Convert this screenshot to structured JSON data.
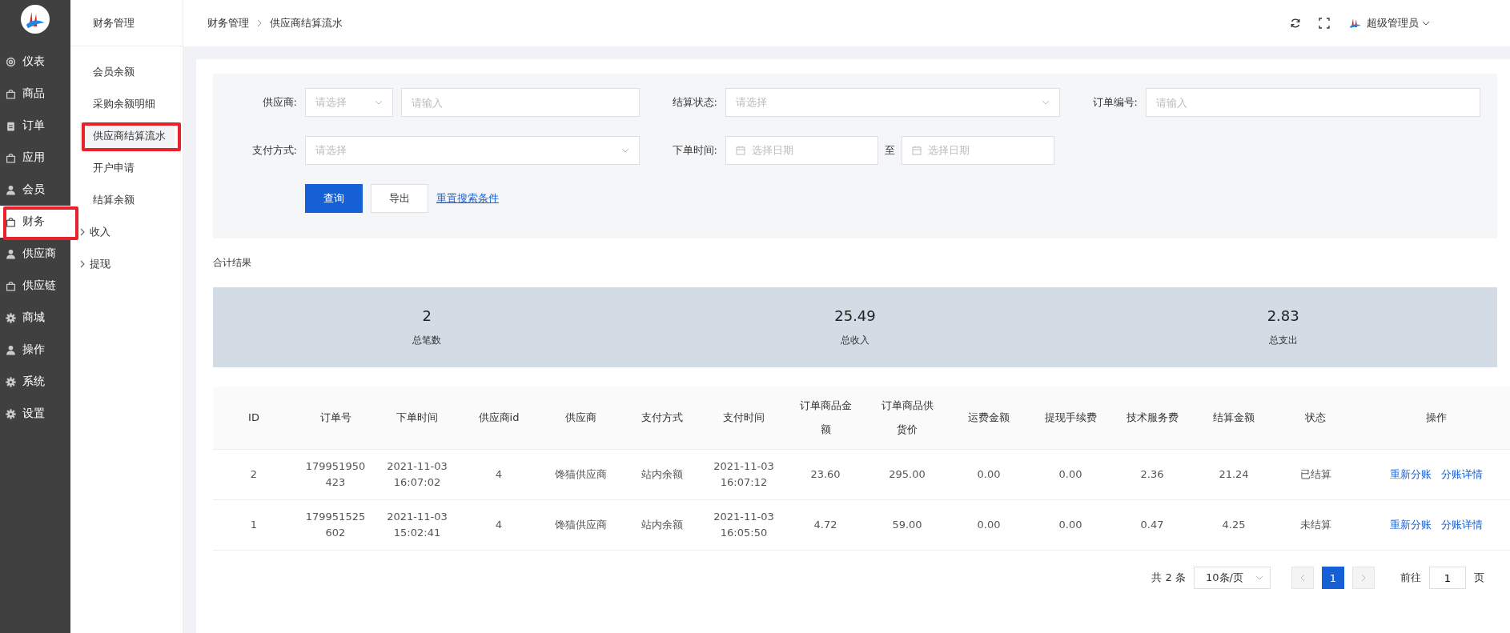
{
  "sidebar": {
    "items": [
      {
        "label": "仪表",
        "selected": false,
        "highlighted": false
      },
      {
        "label": "商品",
        "selected": false,
        "highlighted": false
      },
      {
        "label": "订单",
        "selected": false,
        "highlighted": false
      },
      {
        "label": "应用",
        "selected": false,
        "highlighted": false
      },
      {
        "label": "会员",
        "selected": false,
        "highlighted": false
      },
      {
        "label": "财务",
        "selected": true,
        "highlighted": true
      },
      {
        "label": "供应商",
        "selected": false,
        "highlighted": false
      },
      {
        "label": "供应链",
        "selected": false,
        "highlighted": false
      },
      {
        "label": "商城",
        "selected": false,
        "highlighted": false
      },
      {
        "label": "操作",
        "selected": false,
        "highlighted": false
      },
      {
        "label": "系统",
        "selected": false,
        "highlighted": false
      },
      {
        "label": "设置",
        "selected": false,
        "highlighted": false
      }
    ]
  },
  "submenu": {
    "title": "财务管理",
    "items": [
      {
        "label": "会员余额",
        "kind": "link",
        "selected": false,
        "highlighted": false
      },
      {
        "label": "采购余额明细",
        "kind": "link",
        "selected": false,
        "highlighted": false
      },
      {
        "label": "供应商结算流水",
        "kind": "link",
        "selected": true,
        "highlighted": true
      },
      {
        "label": "开户申请",
        "kind": "link",
        "selected": false,
        "highlighted": false
      },
      {
        "label": "结算余额",
        "kind": "link",
        "selected": false,
        "highlighted": false
      },
      {
        "label": "收入",
        "kind": "group",
        "selected": false,
        "highlighted": false
      },
      {
        "label": "提现",
        "kind": "group",
        "selected": false,
        "highlighted": false
      }
    ]
  },
  "header": {
    "breadcrumb": [
      "财务管理",
      "供应商结算流水"
    ],
    "user_name": "超级管理员"
  },
  "filters": {
    "rows": [
      [
        {
          "label": "供应商:",
          "controls": [
            {
              "kind": "select",
              "placeholder": "请选择"
            },
            {
              "kind": "input",
              "placeholder": "请输入"
            }
          ]
        },
        {
          "label": "结算状态:",
          "controls": [
            {
              "kind": "select",
              "placeholder": "请选择"
            }
          ]
        },
        {
          "label": "订单编号:",
          "controls": [
            {
              "kind": "input",
              "placeholder": "请输入"
            }
          ]
        }
      ],
      [
        {
          "label": "支付方式:",
          "controls": [
            {
              "kind": "select",
              "placeholder": "请选择"
            }
          ]
        },
        {
          "label": "下单时间:",
          "controls": [
            {
              "kind": "date",
              "placeholder": "选择日期"
            },
            {
              "kind": "separator",
              "text": "至"
            },
            {
              "kind": "date",
              "placeholder": "选择日期"
            }
          ]
        }
      ]
    ],
    "buttons": [
      {
        "label": "查询",
        "kind": "primary"
      },
      {
        "label": "导出",
        "kind": "default"
      },
      {
        "label": "重置搜索条件",
        "kind": "link"
      }
    ]
  },
  "summary": {
    "title": "合计结果",
    "stats": [
      {
        "value": "2",
        "label": "总笔数"
      },
      {
        "value": "25.49",
        "label": "总收入"
      },
      {
        "value": "2.83",
        "label": "总支出"
      }
    ]
  },
  "table": {
    "columns": [
      "ID",
      "订单号",
      "下单时间",
      "供应商id",
      "供应商",
      "支付方式",
      "支付时间",
      "订单商品金额",
      "订单商品供货价",
      "运费金额",
      "提现手续费",
      "技术服务费",
      "结算金额",
      "状态",
      "操作"
    ],
    "rows": [
      {
        "cells": [
          "2",
          "179951950423",
          "2021-11-03 16:07:02",
          "4",
          "馋猫供应商",
          "站内余额",
          "2021-11-03 16:07:12",
          "23.60",
          "295.00",
          "0.00",
          "0.00",
          "2.36",
          "21.24",
          "已结算"
        ],
        "actions": [
          "重新分账",
          "分账详情"
        ]
      },
      {
        "cells": [
          "1",
          "179951525602",
          "2021-11-03 15:02:41",
          "4",
          "馋猫供应商",
          "站内余额",
          "2021-11-03 16:05:50",
          "4.72",
          "59.00",
          "0.00",
          "0.00",
          "0.47",
          "4.25",
          "未结算"
        ],
        "actions": [
          "重新分账",
          "分账详情"
        ]
      }
    ]
  },
  "pagination": {
    "total": "共 2 条",
    "page_size": "10条/页",
    "pages": [
      {
        "label": "1",
        "selected": true
      }
    ],
    "goto_label": "前往",
    "goto_value": "1",
    "page_unit": "页"
  }
}
